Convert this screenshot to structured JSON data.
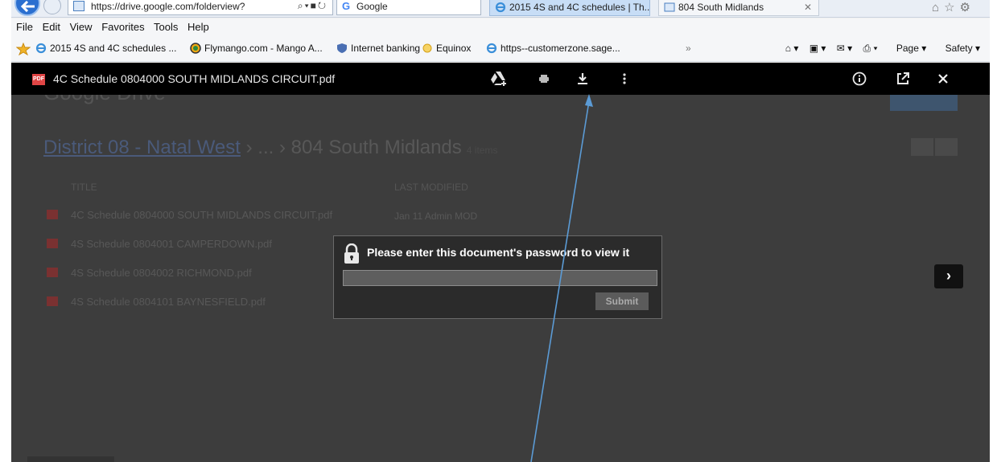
{
  "browser": {
    "url": "https://drive.google.com/folderview?",
    "search_engine": "Google",
    "tabs": [
      {
        "label": "2015 4S and 4C schedules | Th..."
      },
      {
        "label": "804 South Midlands"
      }
    ],
    "menu": [
      "File",
      "Edit",
      "View",
      "Favorites",
      "Tools",
      "Help"
    ],
    "favorites": [
      {
        "label": "2015 4S and 4C schedules ..."
      },
      {
        "label": "Flymango.com - Mango A..."
      },
      {
        "label": "Internet banking"
      },
      {
        "label": "Equinox"
      },
      {
        "label": "https--customerzone.sage..."
      }
    ],
    "command_bar": {
      "page": "Page",
      "safety": "Safety"
    }
  },
  "viewer": {
    "document_title": "4C Schedule 0804000 SOUTH MIDLANDS CIRCUIT.pdf",
    "pdf_badge": "PDF",
    "icons": [
      "add-to-drive-icon",
      "print-icon",
      "download-icon",
      "more-vert-icon",
      "info-icon",
      "open-in-new-icon",
      "close-icon"
    ]
  },
  "background_page": {
    "logo": "Google Drive",
    "breadcrumb": {
      "parent": "District 08 - Natal West",
      "sep": " › ... › ",
      "current": "804 South Midlands",
      "count": "4 items"
    },
    "columns": {
      "title": "TITLE",
      "modified": "LAST MODIFIED"
    },
    "files": [
      {
        "name": "4C Schedule 0804000 SOUTH MIDLANDS CIRCUIT.pdf",
        "modified_date": "Jan 11",
        "modified_by": "Admin MOD"
      },
      {
        "name": "4S Schedule 0804001 CAMPERDOWN.pdf"
      },
      {
        "name": "4S Schedule 0804002 RICHMOND.pdf"
      },
      {
        "name": "4S Schedule 0804101 BAYNESFIELD.pdf"
      }
    ]
  },
  "dialog": {
    "message": "Please enter this document's password to view it",
    "password_value": "",
    "submit_label": "Submit"
  },
  "annotation": {
    "type": "arrow",
    "color": "#5b9bd5",
    "points_to": "download-icon"
  }
}
